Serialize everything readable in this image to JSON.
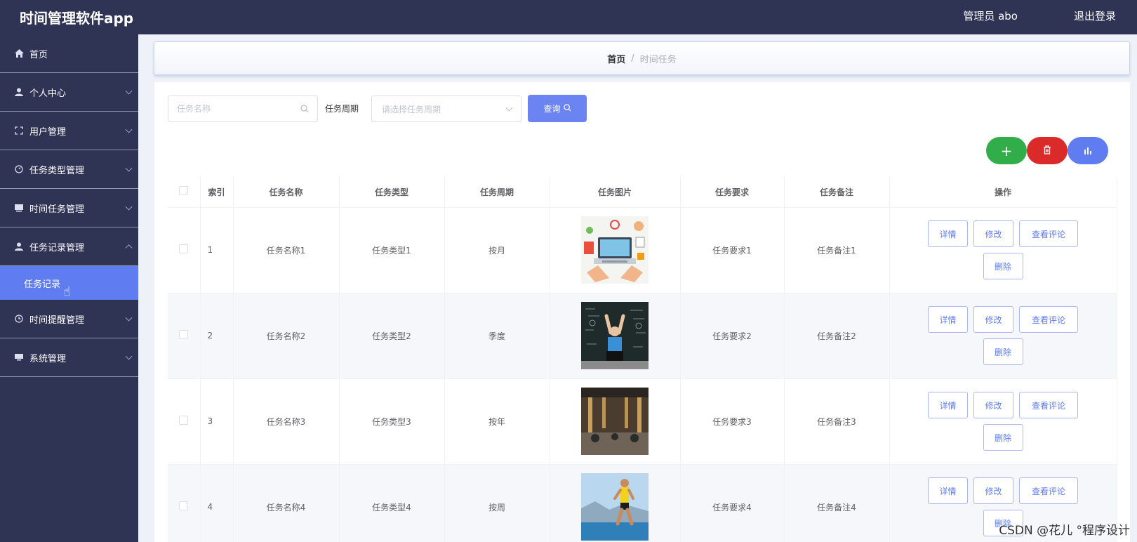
{
  "header": {
    "app_title": "时间管理软件app",
    "admin_label": "管理员 abo",
    "logout_label": "退出登录"
  },
  "sidebar": {
    "items": [
      {
        "label": "首页",
        "icon": "home-icon"
      },
      {
        "label": "个人中心",
        "icon": "user-icon"
      },
      {
        "label": "用户管理",
        "icon": "fullscreen-icon"
      },
      {
        "label": "任务类型管理",
        "icon": "gauge-icon"
      },
      {
        "label": "时间任务管理",
        "icon": "list-icon"
      },
      {
        "label": "任务记录管理",
        "icon": "user-icon"
      },
      {
        "label": "时间提醒管理",
        "icon": "clock-icon"
      },
      {
        "label": "系统管理",
        "icon": "monitor-icon"
      }
    ],
    "active_sub": "任务记录"
  },
  "breadcrumb": {
    "home": "首页",
    "separator": "/",
    "current": "时间任务"
  },
  "search": {
    "name_placeholder": "任务名称",
    "period_label": "任务周期",
    "period_placeholder": "请选择任务周期",
    "query_label": "查询"
  },
  "colors": {
    "sidebar_bg": "#2f3354",
    "accent": "#5f7cf0",
    "add": "#31ae4a",
    "delete": "#da2a2a"
  },
  "table": {
    "headers": [
      "索引",
      "任务名称",
      "任务类型",
      "任务周期",
      "任务图片",
      "任务要求",
      "任务备注",
      "操作"
    ],
    "rows": [
      {
        "index": "1",
        "name": "任务名称1",
        "type": "任务类型1",
        "period": "按月",
        "requirement": "任务要求1",
        "remark": "任务备注1"
      },
      {
        "index": "2",
        "name": "任务名称2",
        "type": "任务类型2",
        "period": "季度",
        "requirement": "任务要求2",
        "remark": "任务备注2"
      },
      {
        "index": "3",
        "name": "任务名称3",
        "type": "任务类型3",
        "period": "按年",
        "requirement": "任务要求3",
        "remark": "任务备注3"
      },
      {
        "index": "4",
        "name": "任务名称4",
        "type": "任务类型4",
        "period": "按周",
        "requirement": "任务要求4",
        "remark": "任务备注4"
      }
    ],
    "actions": {
      "detail": "详情",
      "edit": "修改",
      "comments": "查看评论",
      "delete": "删除"
    }
  },
  "watermark": "CSDN @花儿 °程序设计"
}
